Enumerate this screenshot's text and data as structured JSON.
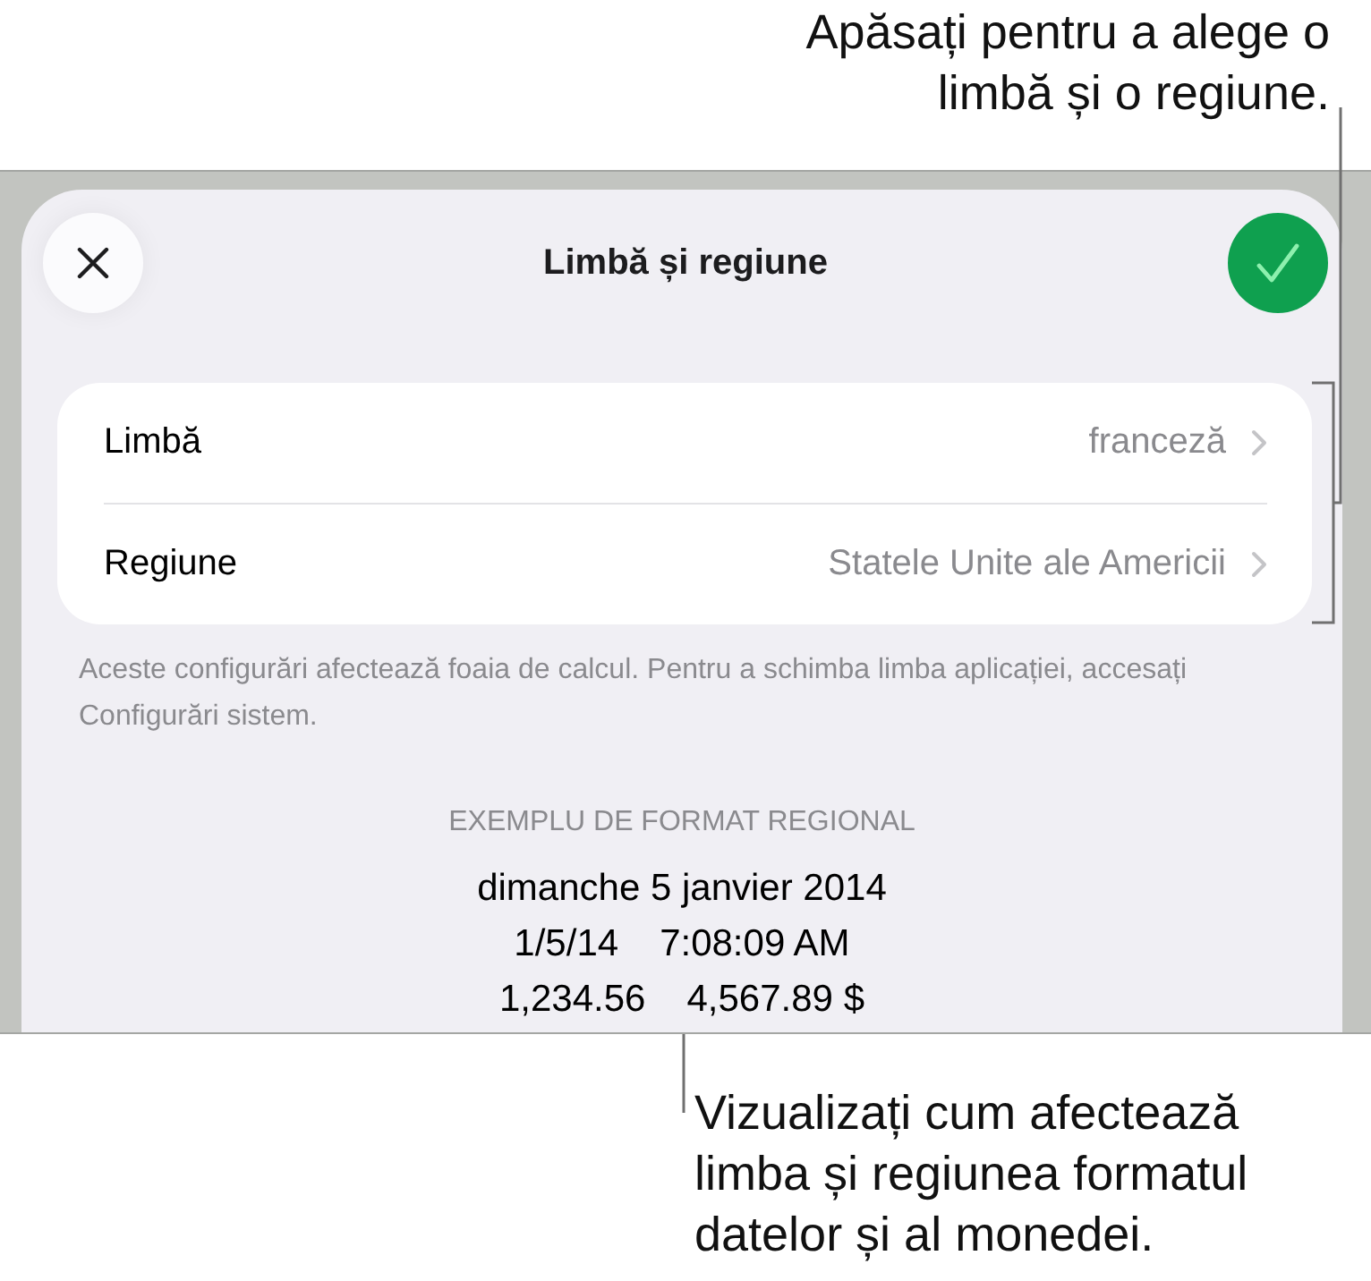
{
  "callout_top": {
    "lines": [
      "Apăsați pentru a alege o",
      "limbă și o regiune."
    ]
  },
  "sheet": {
    "title": "Limbă și regiune",
    "settings": [
      {
        "label": "Limbă",
        "value": "franceză"
      },
      {
        "label": "Regiune",
        "value": "Statele Unite ale Americii"
      }
    ],
    "footnote": "Aceste configurări afectează foaia de calcul. Pentru a schimba limba aplicației, accesați Configurări sistem.",
    "example": {
      "heading": "EXEMPLU DE FORMAT REGIONAL",
      "lines": [
        [
          "dimanche 5 janvier 2014"
        ],
        [
          "1/5/14",
          "7:08:09 AM"
        ],
        [
          "1,234.56",
          "4,567.89 $"
        ]
      ]
    }
  },
  "callout_bottom": {
    "lines": [
      "Vizualizați cum afectează",
      "limba și regiunea formatul",
      "datelor și al monedei."
    ]
  }
}
